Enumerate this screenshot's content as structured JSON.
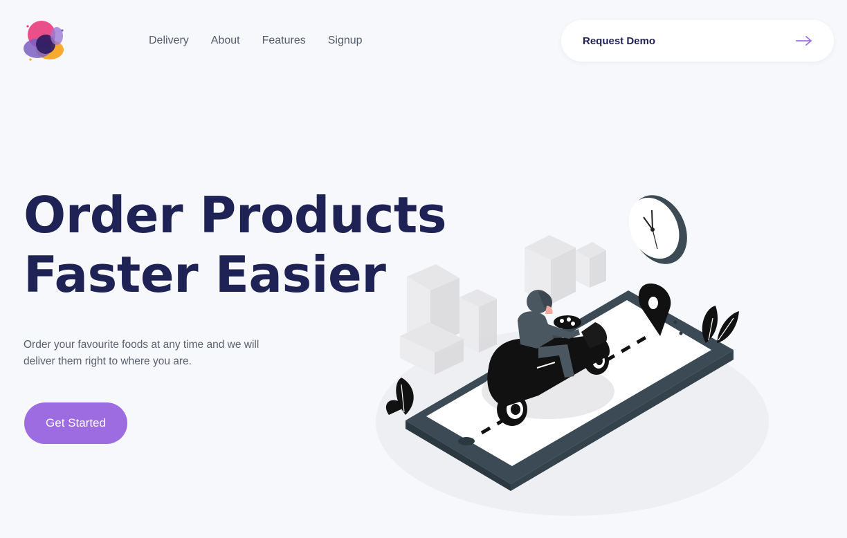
{
  "brand": {
    "logo_icon": "petal-logo-icon",
    "colors": {
      "pink": "#e8407f",
      "purple": "#7b5fc1",
      "orange": "#f5a623",
      "navy": "#2a1a5e"
    }
  },
  "nav": {
    "items": [
      {
        "label": "Delivery"
      },
      {
        "label": "About"
      },
      {
        "label": "Features"
      },
      {
        "label": "Signup"
      }
    ]
  },
  "header": {
    "request_demo_label": "Request Demo",
    "arrow_icon": "arrow-right-icon"
  },
  "hero": {
    "title_line1": "Order Products",
    "title_line2": "Faster Easier",
    "subtitle": "Order your favourite foods at any time and we will deliver them right to where you are.",
    "cta_label": "Get Started"
  },
  "colors": {
    "accent": "#9c6ce0",
    "title": "#1f2254",
    "background": "#f6f8fb"
  }
}
